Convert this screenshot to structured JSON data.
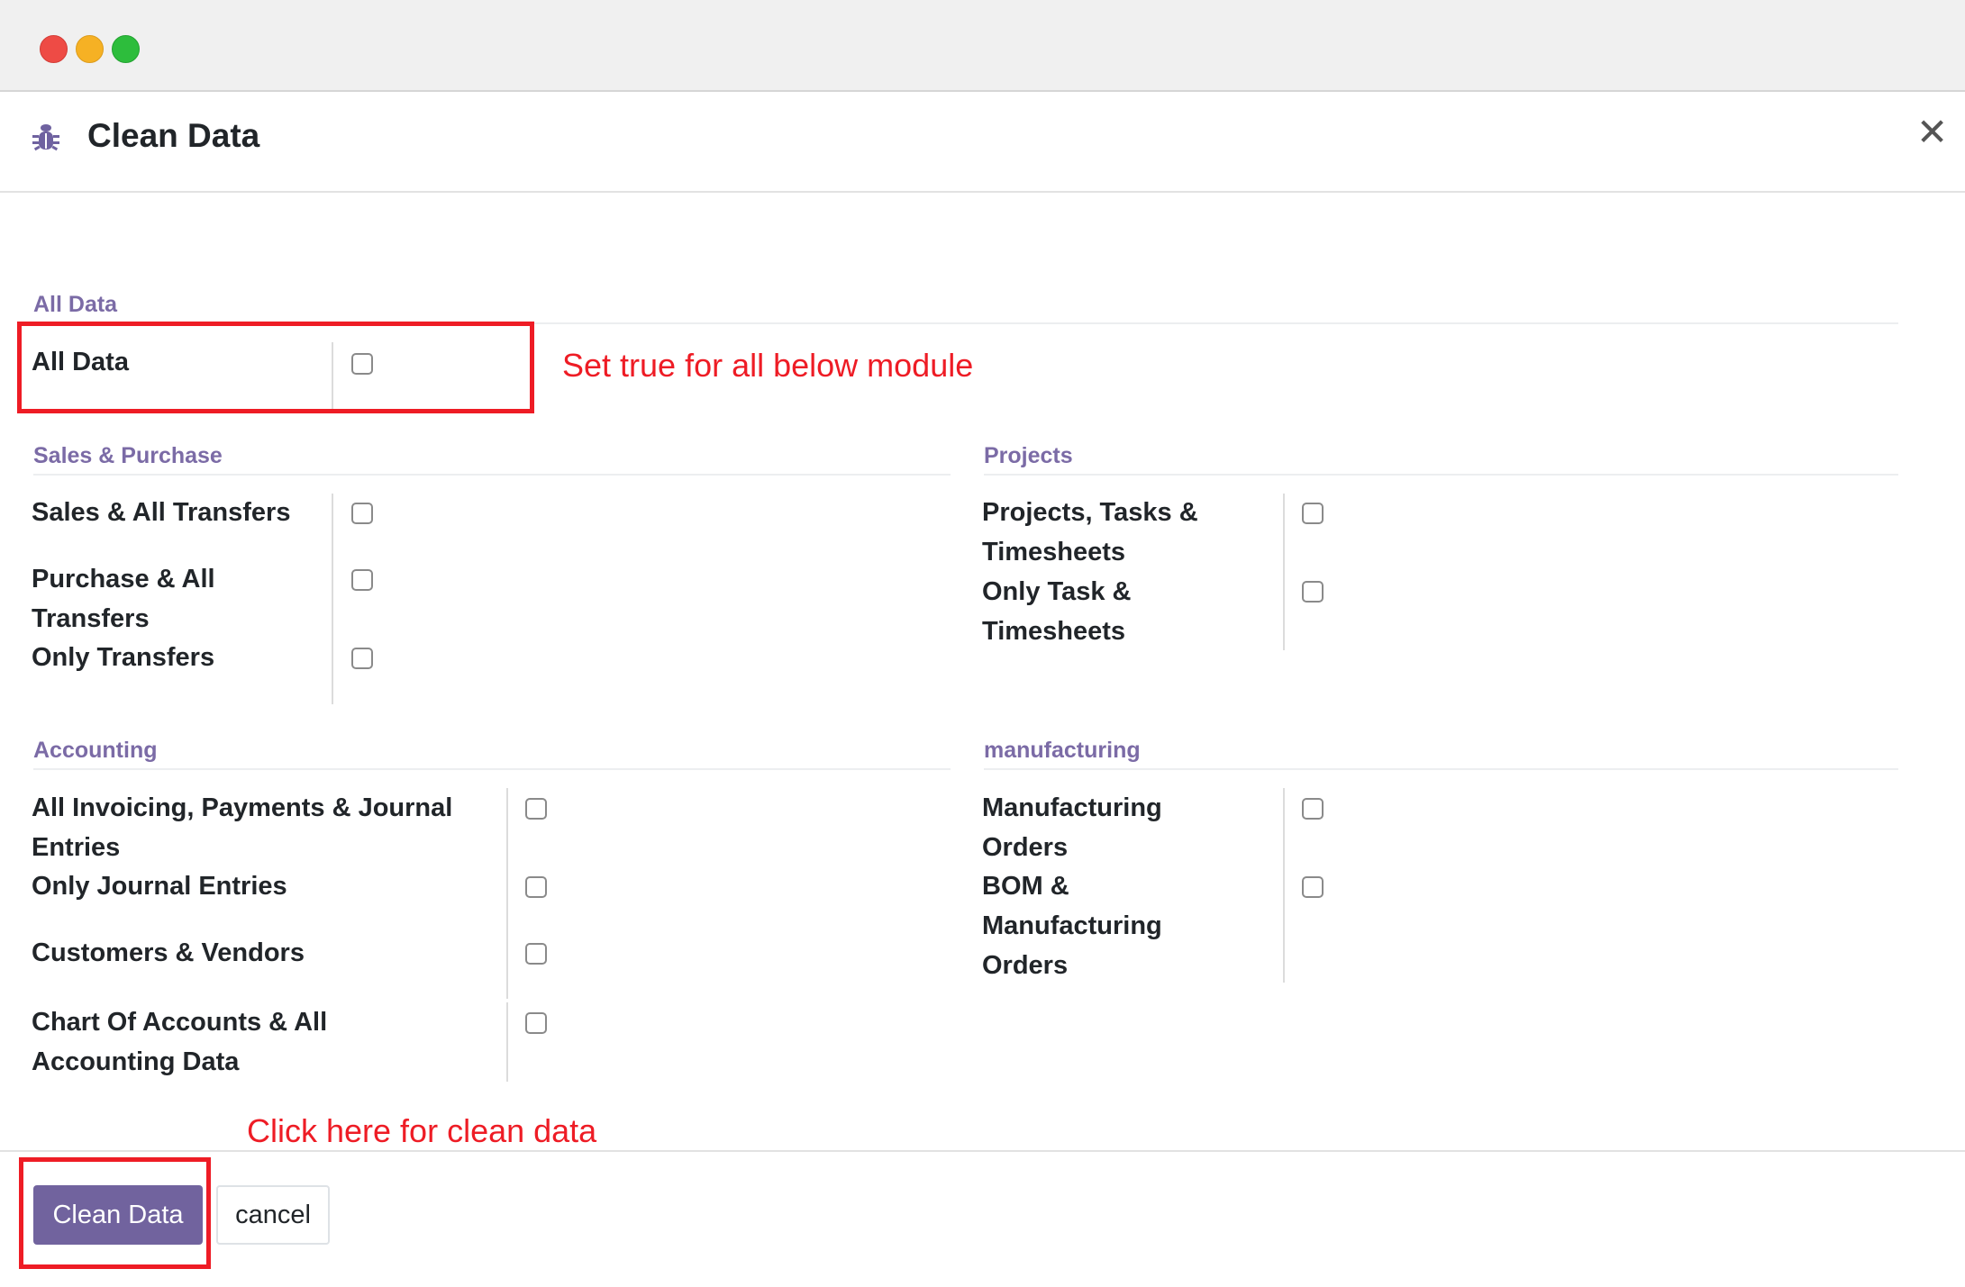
{
  "dialog": {
    "title": "Clean Data",
    "icon": "bug-icon",
    "close_icon": "close-icon"
  },
  "sections": {
    "all_data": {
      "title": "All Data",
      "fields": [
        {
          "label": "All Data",
          "checked": false
        }
      ]
    },
    "sales_purchase": {
      "title": "Sales & Purchase",
      "fields": [
        {
          "label": "Sales & All Transfers",
          "checked": false
        },
        {
          "label": "Purchase & All Transfers",
          "checked": false
        },
        {
          "label": "Only Transfers",
          "checked": false
        }
      ]
    },
    "projects": {
      "title": "Projects",
      "fields": [
        {
          "label": "Projects, Tasks & Timesheets",
          "checked": false
        },
        {
          "label": "Only Task & Timesheets",
          "checked": false
        }
      ]
    },
    "accounting": {
      "title": "Accounting",
      "fields": [
        {
          "label": "All Invoicing, Payments & Journal Entries",
          "checked": false
        },
        {
          "label": "Only Journal Entries",
          "checked": false
        },
        {
          "label": "Customers & Vendors",
          "checked": false
        },
        {
          "label": "Chart Of Accounts & All Accounting Data",
          "checked": false
        }
      ]
    },
    "manufacturing": {
      "title": "manufacturing",
      "fields": [
        {
          "label": "Manufacturing Orders",
          "checked": false
        },
        {
          "label": "BOM & Manufacturing Orders",
          "checked": false
        }
      ]
    }
  },
  "annotations": {
    "all_data_note": "Set true  for all below module",
    "clean_note": "Click here for clean data"
  },
  "footer": {
    "clean_button": "Clean Data",
    "cancel_button": "cancel"
  },
  "colors": {
    "accent": "#71639e",
    "section_title": "#7b6ba6",
    "annotation": "#ee1c25"
  }
}
